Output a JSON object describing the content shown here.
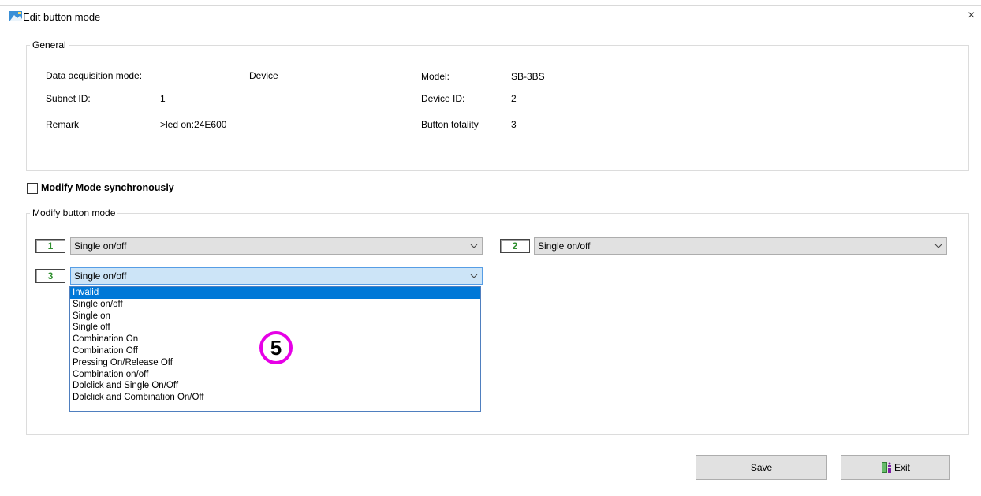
{
  "window": {
    "title": "Edit button mode",
    "close_symbol": "×"
  },
  "general": {
    "legend": "General",
    "data_acquisition_mode_label": "Data acquisition mode:",
    "data_acquisition_mode_value": "Device",
    "model_label": "Model:",
    "model_value": "SB-3BS",
    "subnet_id_label": "Subnet ID:",
    "subnet_id_value": "1",
    "device_id_label": "Device ID:",
    "device_id_value": "2",
    "remark_label": "Remark",
    "remark_value": ">led on:24E600",
    "button_totality_label": "Button totality",
    "button_totality_value": "3"
  },
  "sync_checkbox": {
    "label": "Modify Mode synchronously",
    "checked": false
  },
  "modify": {
    "legend": "Modify button mode",
    "buttons": [
      {
        "number": "1",
        "mode": "Single on/off"
      },
      {
        "number": "2",
        "mode": "Single on/off"
      },
      {
        "number": "3",
        "mode": "Single on/off"
      }
    ],
    "dropdown_options": [
      "Invalid",
      "Single on/off",
      "Single on",
      "Single off",
      "Combination On",
      "Combination Off",
      "Pressing On/Release Off",
      "Combination on/off",
      "Dblclick and Single On/Off",
      "Dblclick and Combination On/Off"
    ],
    "highlighted_option": "Invalid"
  },
  "annotation": {
    "number": "5",
    "color": "#e600e6"
  },
  "footer": {
    "save_label": "Save",
    "exit_label": "Exit"
  },
  "icons": {
    "app": "app-icon",
    "exit": "exit-door-icon",
    "chevron": "chevron-down-icon"
  },
  "colors": {
    "number_text": "#2f8f2f",
    "selection": "#0078d7",
    "button_bg": "#e1e1e1"
  }
}
